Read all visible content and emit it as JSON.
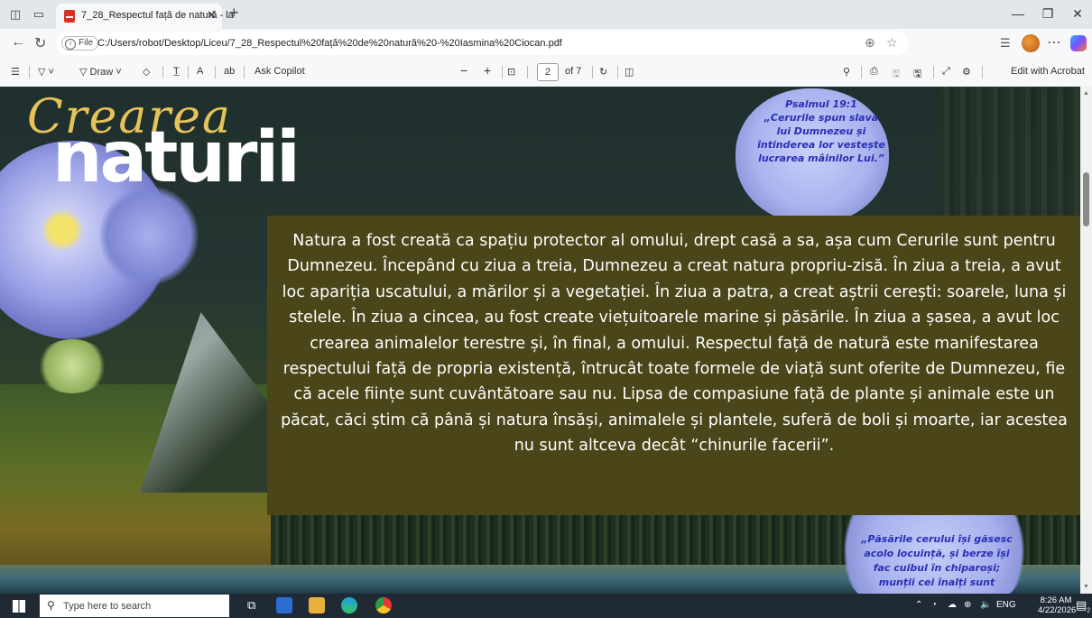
{
  "browser": {
    "tab_title": "7_28_Respectul față de natură - la",
    "url": "C:/Users/robot/Desktop/Liceu/7_28_Respectul%20față%20de%20natură%20-%20Iasmina%20Ciocan.pdf",
    "file_chip": "File"
  },
  "pdf_toolbar": {
    "draw_label": "Draw",
    "ask_copilot_label": "Ask Copilot",
    "page_current": "2",
    "page_total": "of 7",
    "edit_label": "Edit with Acrobat"
  },
  "page": {
    "title_script": "Crearea",
    "title_big": "naturii",
    "quote_top": [
      "Psalmul 19:1",
      "„Cerurile spun slava",
      "lui Dumnezeu și",
      "întinderea lor vestește",
      "lucrarea mâinilor Lui.”"
    ],
    "main_text": "Natura a fost creată ca spațiu protector al omului, drept casă a sa, așa cum Cerurile sunt pentru Dumnezeu. Începând cu ziua a treia, Dumnezeu a creat natura propriu-zisă. În ziua a treia, a avut loc apariția uscatului, a mărilor și a vegetației. În ziua a patra, a creat aștrii cerești: soarele, luna și stelele. În ziua a cincea, au fost create viețuitoarele marine și păsările. În ziua a șasea, a avut loc crearea animalelor terestre și, în final, a omului. Respectul față de natură este manifestarea respectului față de propria existență, întrucât toate formele de viață sunt oferite de Dumnezeu, fie că acele ființe sunt cuvântătoare sau nu. Lipsa de compasiune față de plante și animale este un păcat, căci știm că până și natura însăși, animalele și plantele, suferă de boli și moarte, iar acestea nu sunt altceva decât “chinurile facerii”.",
    "quote_bottom": [
      "„Păsările cerului își găsesc",
      "acolo locuință, și berze își",
      "fac cuibul în chiparoși;",
      "munții cei înalți sunt"
    ]
  },
  "taskbar": {
    "search_placeholder": "Type here to search",
    "lang": "ENG",
    "time": "8:26 AM",
    "date": "4/22/2026",
    "notification_count": "2"
  },
  "colors": {
    "text_panel": "#4a4619",
    "quote_text": "#2a2fb8",
    "title_script": "#e6c25a"
  }
}
